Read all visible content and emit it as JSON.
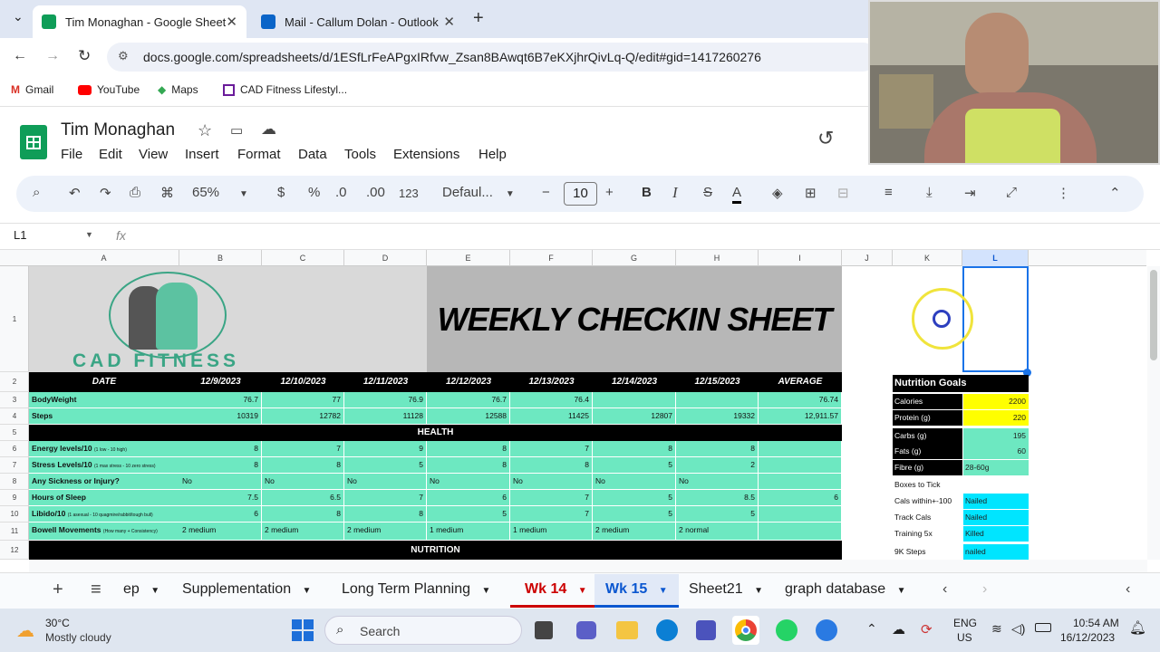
{
  "browser": {
    "tabs": [
      {
        "title": "Tim Monaghan - Google Sheets",
        "active": true
      },
      {
        "title": "Mail - Callum Dolan - Outlook",
        "active": false
      }
    ],
    "url": "docs.google.com/spreadsheets/d/1ESfLrFeAPgxIRfvw_Zsan8BAwqt6B7eKXjhrQivLq-Q/edit#gid=1417260276",
    "bookmarks": [
      "Gmail",
      "YouTube",
      "Maps",
      "CAD Fitness Lifestyl..."
    ]
  },
  "doc": {
    "title": "Tim Monaghan",
    "menu": [
      "File",
      "Edit",
      "View",
      "Insert",
      "Format",
      "Data",
      "Tools",
      "Extensions",
      "Help"
    ]
  },
  "toolbar": {
    "zoom": "65%",
    "currency": "$",
    "percent": "%",
    "dec_less": ".0",
    "dec_more": ".00",
    "format_123": "123",
    "font": "Defaul...",
    "font_size": "10",
    "minus": "−",
    "plus": "+",
    "bold": "B",
    "italic": "I",
    "strike": "S",
    "textcolor": "A"
  },
  "formula": {
    "cell_ref": "L1",
    "fx": "fx"
  },
  "columns": [
    "A",
    "B",
    "C",
    "D",
    "E",
    "F",
    "G",
    "H",
    "I",
    "J",
    "K",
    "L"
  ],
  "rows": [
    "1",
    "2",
    "3",
    "4",
    "5",
    "6",
    "7",
    "8",
    "9",
    "10",
    "11",
    "12"
  ],
  "sheet": {
    "logo_text": "CAD FITNESS",
    "banner": "WEEKLY CHECKIN SHEET",
    "header_row": [
      "DATE",
      "12/9/2023",
      "12/10/2023",
      "12/11/2023",
      "12/12/2023",
      "12/13/2023",
      "12/14/2023",
      "12/15/2023",
      "AVERAGE"
    ],
    "bodyweight": {
      "label": "BodyWeight",
      "values": [
        "76.7",
        "77",
        "76.9",
        "76.7",
        "76.4",
        "",
        "",
        "76.74"
      ]
    },
    "steps": {
      "label": "Steps",
      "values": [
        "10319",
        "12782",
        "11128",
        "12588",
        "11425",
        "12807",
        "19332",
        "12,911.57"
      ]
    },
    "health_header": "HEALTH",
    "energy": {
      "label": "Energy levels/10",
      "sub": "(1 low - 10 high)",
      "values": [
        "8",
        "7",
        "9",
        "8",
        "7",
        "8",
        "8",
        ""
      ]
    },
    "stress": {
      "label": "Stress Levels/10",
      "sub": "(1 max stress - 10 zero stress)",
      "values": [
        "8",
        "8",
        "5",
        "8",
        "8",
        "5",
        "2",
        ""
      ]
    },
    "sickness": {
      "label": "Any Sickness or Injury?",
      "values": [
        "No",
        "No",
        "No",
        "No",
        "No",
        "No",
        "No",
        ""
      ]
    },
    "sleep": {
      "label": "Hours of Sleep",
      "values": [
        "7.5",
        "6.5",
        "7",
        "6",
        "7",
        "5",
        "8.5",
        "6"
      ]
    },
    "libido": {
      "label": "Libido/10",
      "sub": "(1 asexual - 10 quagmire/rabbit/tough bull)",
      "values": [
        "6",
        "8",
        "8",
        "5",
        "7",
        "5",
        "5",
        ""
      ]
    },
    "bowel": {
      "label": "Bowell Movements",
      "sub": "(How many + Consistency)",
      "values": [
        "2 medium",
        "2 medium",
        "2 medium",
        "1 medium",
        "1 medium",
        "2 medium",
        "2 normal",
        ""
      ]
    },
    "nutrition_header": "NUTRITION"
  },
  "nutrition_goals": {
    "title": "Nutrition Goals",
    "items": [
      {
        "label": "Calories",
        "value": "2200",
        "color": "#ffff00"
      },
      {
        "label": "Protein (g)",
        "value": "220",
        "color": "#ffff00"
      },
      {
        "label": "Carbs (g)",
        "value": "195",
        "color": "#6de8c1"
      },
      {
        "label": "Fats (g)",
        "value": "60",
        "color": "#6de8c1"
      },
      {
        "label": "Fibre (g)",
        "value": "28-60g",
        "color": "#6de8c1"
      }
    ],
    "ticks_title": "Boxes to Tick",
    "ticks": [
      {
        "label": "Cals within+-100",
        "value": "Nailed"
      },
      {
        "label": "Track Cals",
        "value": "Nailed"
      },
      {
        "label": "Training 5x",
        "value": "Killed"
      },
      {
        "label": "9K Steps",
        "value": "nailed"
      }
    ]
  },
  "sheet_tabs": [
    "ep",
    "Supplementation",
    "Long Term Planning",
    "Wk 14",
    "Wk 15",
    "Sheet21",
    "graph database"
  ],
  "active_sheet": "Wk 15",
  "taskbar": {
    "weather_temp": "30°C",
    "weather_desc": "Mostly cloudy",
    "search": "Search",
    "lang1": "ENG",
    "lang2": "US",
    "time": "10:54 AM",
    "date": "16/12/2023"
  }
}
